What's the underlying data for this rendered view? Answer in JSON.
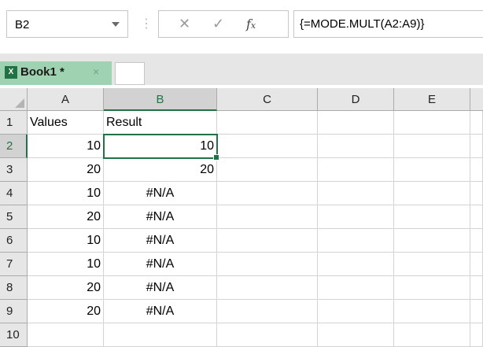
{
  "formula_bar": {
    "name_box": "B2",
    "cancel_icon": "close-icon",
    "enter_icon": "check-icon",
    "fx_label": "fx",
    "formula": "{=MODE.MULT(A2:A9)}"
  },
  "workbook_tab": {
    "icon": "excel-icon",
    "title": "Book1 *",
    "close_glyph": "×"
  },
  "grid": {
    "columns": [
      "A",
      "B",
      "C",
      "D",
      "E"
    ],
    "selected_cell": "B2",
    "rows": [
      {
        "num": "1",
        "A": "Values",
        "B": "Result"
      },
      {
        "num": "2",
        "A": "10",
        "B": "10"
      },
      {
        "num": "3",
        "A": "20",
        "B": "20"
      },
      {
        "num": "4",
        "A": "10",
        "B": "#N/A"
      },
      {
        "num": "5",
        "A": "20",
        "B": "#N/A"
      },
      {
        "num": "6",
        "A": "10",
        "B": "#N/A"
      },
      {
        "num": "7",
        "A": "10",
        "B": "#N/A"
      },
      {
        "num": "8",
        "A": "20",
        "B": "#N/A"
      },
      {
        "num": "9",
        "A": "20",
        "B": "#N/A"
      },
      {
        "num": "10",
        "A": "",
        "B": ""
      }
    ]
  },
  "colors": {
    "accent": "#217346",
    "tab_bg": "#9fd2b0",
    "header_bg": "#e6e6e6"
  }
}
